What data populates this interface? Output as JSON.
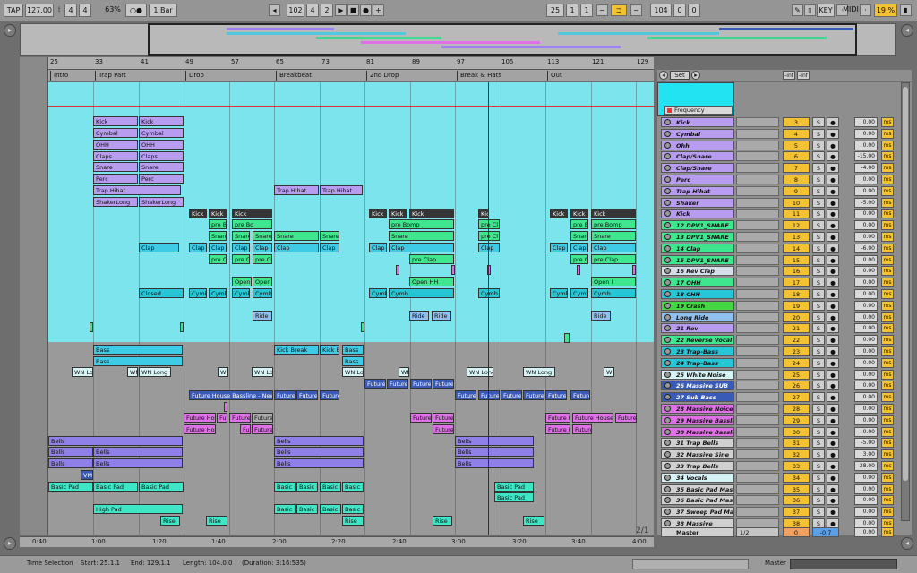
{
  "transport": {
    "tap": "TAP",
    "tempo": "127.00",
    "signature_num": "4",
    "signature_den": "4",
    "cpu": "63%",
    "quantize": "1 Bar",
    "pos_bar": "102",
    "pos_beat": "4",
    "pos_sixteenth": "2",
    "loop_start_bar": "25",
    "loop_start_beat": "1",
    "loop_start_sixteenth": "1",
    "loop_len_bar": "104",
    "loop_len_beat": "0",
    "loop_len_sixteenth": "0",
    "key": "KEY",
    "midi": "MIDI",
    "load": "19 %"
  },
  "ruler": {
    "bars": [
      "25",
      "33",
      "41",
      "49",
      "57",
      "65",
      "73",
      "81",
      "89",
      "97",
      "105",
      "113",
      "121",
      "129"
    ]
  },
  "locators": [
    "Intro",
    "Trap Part",
    "Drop",
    "Breakbeat",
    "2nd Drop",
    "Break & Hats",
    "Out"
  ],
  "header_controls": {
    "set_label": "Set",
    "minus_inf_1": "-inf",
    "minus_inf_2": "-inf",
    "frequency_label": "Frequency"
  },
  "clips": {
    "kick": "Kick",
    "cymbal": "Cymbal",
    "ohh": "OHH",
    "claps": "Claps",
    "snare": "Snare",
    "perc": "Perc",
    "trap_hihat": "Trap Hihat",
    "shakerlong": "ShakerLong",
    "pre_bo": "pre Bo",
    "pre_bomp": "pre Bomp",
    "clap": "Clap",
    "pre_cl": "pre Cl",
    "pre_clap": "pre Clap",
    "open": "Open I",
    "open_hh": "Open HH",
    "closed": "Closed",
    "cymb": "Cymb",
    "cymb_full": "Cymb",
    "ride": "Ride",
    "bass": "Bass",
    "kick_break": "Kick Break",
    "kick_b": "Kick B",
    "wn_long": "WN Long",
    "wn_lon": "WN Lon",
    "wn": "WN",
    "future_bassline": "Future House Bassline - New...",
    "future": "Future",
    "future_hou": "Future Hou",
    "future_ho": "Future Ho",
    "future_i": "Future I",
    "future_h": "Future H",
    "future_house_bass": "Future House Bas",
    "fut": "Fut",
    "bells": "Bells",
    "vm": "VM",
    "basic_pad": "Basic Pad",
    "basic_p": "Basic P",
    "high_pad": "High Pad",
    "rise": "Rise"
  },
  "tracks": [
    {
      "name": "Kick",
      "num": "3",
      "vol": "0.00",
      "color": "#b79cf0"
    },
    {
      "name": "Cymbal",
      "num": "4",
      "vol": "0.00",
      "color": "#b79cf0"
    },
    {
      "name": "Ohh",
      "num": "5",
      "vol": "0.00",
      "color": "#b79cf0"
    },
    {
      "name": "Clap/Snare",
      "num": "6",
      "vol": "-15.00",
      "color": "#b79cf0"
    },
    {
      "name": "Clap/Snare",
      "num": "7",
      "vol": "-4.00",
      "color": "#b79cf0"
    },
    {
      "name": "Perc",
      "num": "8",
      "vol": "0.00",
      "color": "#b79cf0"
    },
    {
      "name": "Trap Hihat",
      "num": "9",
      "vol": "0.00",
      "color": "#b79cf0"
    },
    {
      "name": "Shaker",
      "num": "10",
      "vol": "-5.00",
      "color": "#b79cf0"
    },
    {
      "name": "Kick",
      "num": "11",
      "vol": "0.00",
      "color": "#b79cf0"
    },
    {
      "name": "12 DPV1_SNARE",
      "num": "12",
      "vol": "0.00",
      "color": "#3ee68e"
    },
    {
      "name": "13 DPV1_SNARE",
      "num": "13",
      "vol": "0.00",
      "color": "#3ee68e"
    },
    {
      "name": "14 Clap",
      "num": "14",
      "vol": "-6.00",
      "color": "#3ee68e"
    },
    {
      "name": "15 DPV1_SNARE",
      "num": "15",
      "vol": "0.00",
      "color": "#3ee68e"
    },
    {
      "name": "16 Rev Clap",
      "num": "16",
      "vol": "0.00",
      "color": "#d5dde8"
    },
    {
      "name": "17 OHH",
      "num": "17",
      "vol": "0.00",
      "color": "#3ee68e"
    },
    {
      "name": "18 CHH",
      "num": "18",
      "vol": "0.00",
      "color": "#26c6d6"
    },
    {
      "name": "19 Crash",
      "num": "19",
      "vol": "0.00",
      "color": "#43d843"
    },
    {
      "name": "Long Ride",
      "num": "20",
      "vol": "0.00",
      "color": "#8fc0f0"
    },
    {
      "name": "21 Rev",
      "num": "21",
      "vol": "0.00",
      "color": "#b79cf0"
    },
    {
      "name": "22 Reverse Vocal",
      "num": "22",
      "vol": "0.00",
      "color": "#3ee68e"
    },
    {
      "name": "23 Trap-Bass",
      "num": "23",
      "vol": "0.00",
      "color": "#26c6d6"
    },
    {
      "name": "24 Trap-Bass",
      "num": "24",
      "vol": "0.00",
      "color": "#26c6d6"
    },
    {
      "name": "25 White Noise",
      "num": "25",
      "vol": "0.00",
      "color": "#d5f2f4"
    },
    {
      "name": "26 Massive SUB",
      "num": "26",
      "vol": "0.00",
      "color": "#3a5ab8"
    },
    {
      "name": "27 Sub Bass",
      "num": "27",
      "vol": "0.00",
      "color": "#3a5ab8"
    },
    {
      "name": "28 Massive Noice",
      "num": "28",
      "vol": "0.00",
      "color": "#e070e8"
    },
    {
      "name": "29 Massive Basslin",
      "num": "29",
      "vol": "0.00",
      "color": "#e070e8"
    },
    {
      "name": "30 Massive Basslin",
      "num": "30",
      "vol": "0.00",
      "color": "#e070e8"
    },
    {
      "name": "31 Trap Bells",
      "num": "31",
      "vol": "-5.00",
      "color": "#d0d0d0"
    },
    {
      "name": "32 Massive Sine",
      "num": "32",
      "vol": "3.00",
      "color": "#d0d0d0"
    },
    {
      "name": "33 Trap Bells",
      "num": "33",
      "vol": "28.00",
      "color": "#d0d0d0"
    },
    {
      "name": "34 Vocals",
      "num": "34",
      "vol": "0.00",
      "color": "#d5f2f4"
    },
    {
      "name": "35 Basic Pad Massi",
      "num": "35",
      "vol": "0.00",
      "color": "#d0d0d0"
    },
    {
      "name": "36 Basic Pad Massi",
      "num": "36",
      "vol": "0.00",
      "color": "#d0d0d0"
    },
    {
      "name": "37 Sweep Pad Mas",
      "num": "37",
      "vol": "0.00",
      "color": "#d0d0d0"
    },
    {
      "name": "38 Massive",
      "num": "38",
      "vol": "0.00",
      "color": "#d0d0d0"
    }
  ],
  "master": {
    "name": "Master",
    "routing": "1/2",
    "num": "0",
    "peak": "-0.7",
    "vol": "0.00"
  },
  "ms_label": "ms",
  "solo_label": "S",
  "zoom_label": "2/1",
  "timeline": [
    "0:40",
    "1:00",
    "1:20",
    "1:40",
    "2:00",
    "2:20",
    "2:40",
    "3:00",
    "3:20",
    "3:40",
    "4:00"
  ],
  "status": {
    "label": "Time Selection",
    "start": "Start: 25.1.1",
    "end": "End: 129.1.1",
    "length": "Length: 104.0.0",
    "duration": "(Duration: 3:16:535)",
    "master": "Master"
  }
}
